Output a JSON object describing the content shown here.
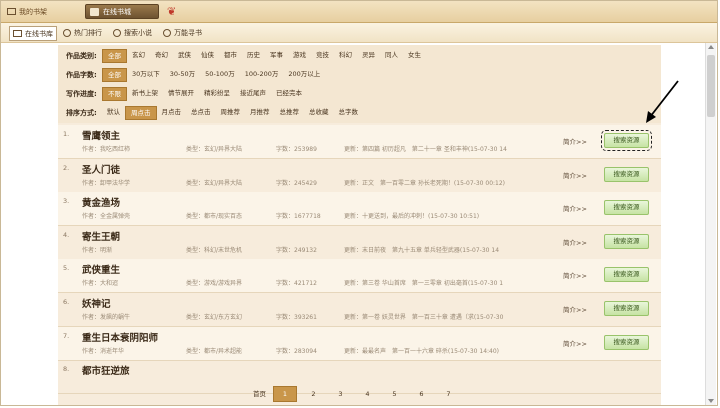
{
  "topbar": {
    "shelf_label": "我的书架",
    "online_tab_label": "在线书城"
  },
  "navbar": {
    "items": [
      {
        "label": "在线书库",
        "icon": "book-icon"
      },
      {
        "label": "热门排行",
        "icon": "fire-icon"
      },
      {
        "label": "搜索小说",
        "icon": "search-icon"
      },
      {
        "label": "万能寻书",
        "icon": "compass-icon"
      }
    ]
  },
  "filters": {
    "category": {
      "label": "作品类别:",
      "options": [
        "全部",
        "玄幻",
        "奇幻",
        "武侠",
        "仙侠",
        "都市",
        "历史",
        "军事",
        "游戏",
        "竞技",
        "科幻",
        "灵异",
        "同人",
        "女生"
      ],
      "selected": "全部"
    },
    "wordcount": {
      "label": "作品字数:",
      "options": [
        "全部",
        "30万以下",
        "30-50万",
        "50-100万",
        "100-200万",
        "200万以上"
      ],
      "selected": "全部"
    },
    "progress": {
      "label": "写作进度:",
      "options": [
        "不限",
        "新书上架",
        "情节展开",
        "精彩纷呈",
        "接近尾声",
        "已经完本"
      ],
      "selected": "不限"
    },
    "sort": {
      "label": "排序方式:",
      "options": [
        "默认",
        "周点击",
        "月点击",
        "总点击",
        "周推荐",
        "月推荐",
        "总推荐",
        "总收藏",
        "总字数"
      ],
      "selected": "周点击"
    }
  },
  "books": [
    {
      "num": "1.",
      "title": "雪鹰领主",
      "author": "作者：我吃西红柿",
      "type": "类型：玄幻/异界大陆",
      "words": "字数：253989",
      "update": "更新：第四篇 初历超凡　第二十一章 圣和丰神(15-07-30 14"
    },
    {
      "num": "2.",
      "title": "圣人门徒",
      "author": "作者：卸甲法华学",
      "type": "类型：玄幻/异界大陆",
      "words": "字数：245429",
      "update": "更新：正文　第一百零二章 孙长老死期！(15-07-30 00:12)"
    },
    {
      "num": "3.",
      "title": "黄金渔场",
      "author": "作者：全金属弹壳",
      "type": "类型：都市/现实百态",
      "words": "字数：1677718",
      "update": "更新：十更送到，最后的冲刺！(15-07-30 10:51)"
    },
    {
      "num": "4.",
      "title": "寄生王朝",
      "author": "作者：明渐",
      "type": "类型：科幻/末世危机",
      "words": "字数：249132",
      "update": "更新：末日前夜　第九十五章 单兵轻型武器(15-07-30 14"
    },
    {
      "num": "5.",
      "title": "武侠重生",
      "author": "作者：大和迢",
      "type": "类型：游戏/游戏异界",
      "words": "字数：421712",
      "update": "更新：第三卷 华山首席　第一三零章 初出毫首(15-07-30 1"
    },
    {
      "num": "6.",
      "title": "妖神记",
      "author": "作者：发飙的蜗牛",
      "type": "类型：玄幻/东方玄幻",
      "words": "字数：393261",
      "update": "更新：第一卷 妖灵世界　第一百三十章 遭遇（求(15-07-30"
    },
    {
      "num": "7.",
      "title": "重生日本衰阴阳师",
      "author": "作者：消逝年华",
      "type": "类型：都市/异术超能",
      "words": "字数：283094",
      "update": "更新：最最名声　第一百一十六章 碎杀(15-07-30 14:40)"
    },
    {
      "num": "8.",
      "title": "都市狂逆旅",
      "author": "",
      "type": "",
      "words": "",
      "update": ""
    }
  ],
  "book_intro_label": "简介>>",
  "resource_button_label": "搜索资源",
  "pager": {
    "first_label": "首页",
    "pages": [
      "1",
      "2",
      "3",
      "4",
      "5",
      "6",
      "7"
    ],
    "current": "1"
  }
}
